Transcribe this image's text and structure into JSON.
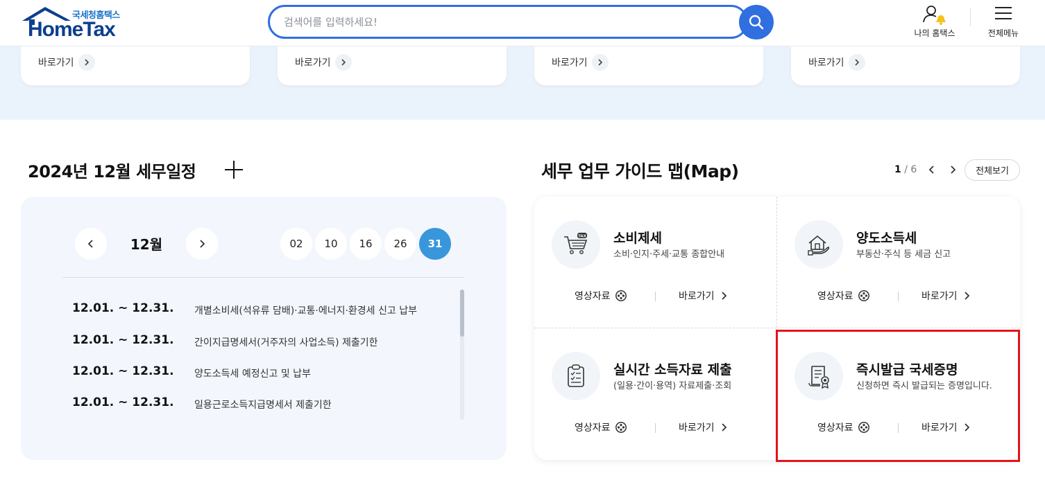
{
  "header": {
    "logo_sub": "국세청홈택스",
    "logo_main": "HomeTax",
    "search_placeholder": "검색어를 입력하세요!",
    "my_hometax_label": "나의 홈택스",
    "all_menu_label": "전체메뉴"
  },
  "quick_cards": [
    {
      "link_label": "바로가기"
    },
    {
      "link_label": "바로가기"
    },
    {
      "link_label": "바로가기"
    },
    {
      "link_label": "바로가기"
    }
  ],
  "schedule": {
    "title": "2024년 12월 세무일정",
    "month_label": "12월",
    "days": [
      "02",
      "10",
      "16",
      "26",
      "31"
    ],
    "active_day": "31",
    "items": [
      {
        "date": "12.01. ~ 12.31.",
        "text": "개별소비세(석유류 담배)·교통·에너지·환경세 신고 납부"
      },
      {
        "date": "12.01. ~ 12.31.",
        "text": "간이지급명세서(거주자의 사업소득) 제출기한"
      },
      {
        "date": "12.01. ~ 12.31.",
        "text": "양도소득세 예정신고 및 납부"
      },
      {
        "date": "12.01. ~ 12.31.",
        "text": "일용근로소득지급명세서 제출기한"
      }
    ]
  },
  "guide": {
    "title": "세무 업무 가이드 맵(Map)",
    "page_current": "1",
    "page_total": "/ 6",
    "view_all_label": "전체보기",
    "cells": [
      {
        "title": "소비제세",
        "desc": "소비·인지·주세·교통 종합안내",
        "video_label": "영상자료",
        "go_label": "바로가기",
        "icon": "shopping-cart-tax-icon"
      },
      {
        "title": "양도소득세",
        "desc": "부동산·주식 등 세금 신고",
        "video_label": "영상자료",
        "go_label": "바로가기",
        "icon": "house-hand-icon"
      },
      {
        "title": "실시간 소득자료 제출",
        "desc": "(일용·간이·용역) 자료제출·조회",
        "video_label": "영상자료",
        "go_label": "바로가기",
        "icon": "clipboard-checklist-icon"
      },
      {
        "title": "즉시발급 국세증명",
        "desc": "신청하면 즉시 발급되는 증명입니다.",
        "video_label": "영상자료",
        "go_label": "바로가기",
        "icon": "certificate-icon"
      }
    ]
  },
  "colors": {
    "brand_blue": "#2f6fe0",
    "logo_navy": "#0d3f8f",
    "band_bg": "#eaf3fc",
    "active_day": "#3a96da",
    "highlight_red": "#e3141b"
  }
}
